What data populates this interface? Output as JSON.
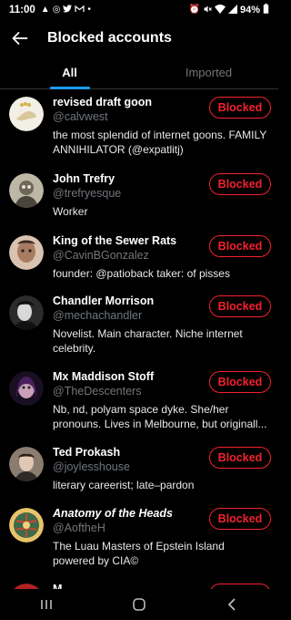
{
  "status_bar": {
    "time": "11:00",
    "left_icons": [
      "alert-icon",
      "signal-app-icon",
      "twitter-icon",
      "gmail-icon",
      "dot-icon"
    ],
    "right_icons": [
      "alarm-icon",
      "mute-icon",
      "wifi-icon",
      "signal-icon"
    ],
    "battery": "94%"
  },
  "header": {
    "title": "Blocked accounts"
  },
  "tabs": [
    {
      "label": "All",
      "active": true
    },
    {
      "label": "Imported",
      "active": false
    }
  ],
  "button_label": "Blocked",
  "accounts": [
    {
      "name": "revised draft goon",
      "handle": "@calvwest",
      "bio": "the most splendid of internet goons. FAMILY ANNIHILATOR (@expatlitj)",
      "avatar_color": "#e9e2c8"
    },
    {
      "name": "John Trefry",
      "handle": "@trefryesque",
      "bio": "Worker",
      "avatar_color": "#8a8577"
    },
    {
      "name": "King of the Sewer Rats",
      "handle": "@CavinBGonzalez",
      "bio": "founder: @patioback  taker: of pisses",
      "avatar_color": "#b08a73"
    },
    {
      "name": "Chandler Morrison",
      "handle": "@mechachandler",
      "bio": "Novelist. Main character. Niche internet celebrity.",
      "avatar_color": "#3a3a3a"
    },
    {
      "name": "Mx Maddison Stoff",
      "handle": "@TheDescenters",
      "bio": "Nb, nd, polyam space dyke. She/her pronouns. Lives in Melbourne, but originall...",
      "avatar_color": "#3b1d4a"
    },
    {
      "name": "Ted Prokash",
      "handle": "@joylesshouse",
      "bio": "literary careerist; late–pardon",
      "avatar_color": "#5a4e44"
    },
    {
      "name": "Anatomy of the Heads",
      "handle": "@AoftheH",
      "bio": "The Luau Masters of Epstein Island powered by CIA©",
      "avatar_color": "#c9a24a"
    },
    {
      "name": "M...",
      "handle": "",
      "bio": "",
      "avatar_color": "#b22222"
    }
  ],
  "colors": {
    "accent": "#1d9bf0",
    "blocked": "#f4212e",
    "secondary_text": "#71767b"
  },
  "nav_bar": {
    "buttons": [
      "recents-icon",
      "home-icon",
      "back-icon"
    ]
  }
}
